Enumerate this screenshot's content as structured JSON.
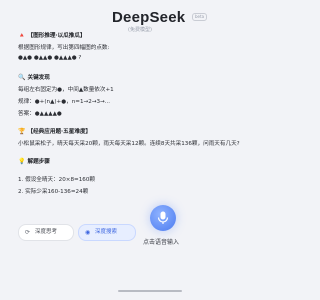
{
  "header": {
    "title": "DeepSeek",
    "badge": "beta",
    "subtitle": "(免费模型)"
  },
  "content": {
    "lines": [
      {
        "kind": "title",
        "emoji": "🔺",
        "text": "【图形推理·以瓜推瓜】"
      },
      {
        "kind": "text",
        "text": "根据图形规律，写出第四幅图的点数:"
      },
      {
        "kind": "text",
        "text": "●▲●  ●▲▲●  ●▲▲▲●  ?"
      },
      {
        "kind": "gap"
      },
      {
        "kind": "title",
        "emoji": "🔍",
        "text": "关键发现"
      },
      {
        "kind": "text",
        "text": "每组左右固定为●，中间▲数量依次+1"
      },
      {
        "kind": "text",
        "text": "规律：●+(n▲)+●，n=1→2→3→..."
      },
      {
        "kind": "text",
        "text": "答案：●▲▲▲▲●"
      },
      {
        "kind": "gap"
      },
      {
        "kind": "title",
        "emoji": "🏆",
        "text": "【经典应用题·五星难度】"
      },
      {
        "kind": "text",
        "text": "小松鼠采松子，晴天每天采20颗，雨天每天采12颗。连续8天共采136颗，问雨天有几天?"
      },
      {
        "kind": "gap"
      },
      {
        "kind": "title",
        "emoji": "💡",
        "text": "解题步骤"
      },
      {
        "kind": "gap"
      },
      {
        "kind": "text",
        "text": "1. 假设全晴天：20×8=160颗"
      },
      {
        "kind": "text",
        "text": "2. 实际少采160-136=24颗"
      }
    ]
  },
  "chips": [
    {
      "icon": "⟳",
      "label": "深度思考"
    },
    {
      "icon": "◉",
      "label": "深度搜索"
    }
  ],
  "voice": {
    "label": "点击语音输入"
  }
}
